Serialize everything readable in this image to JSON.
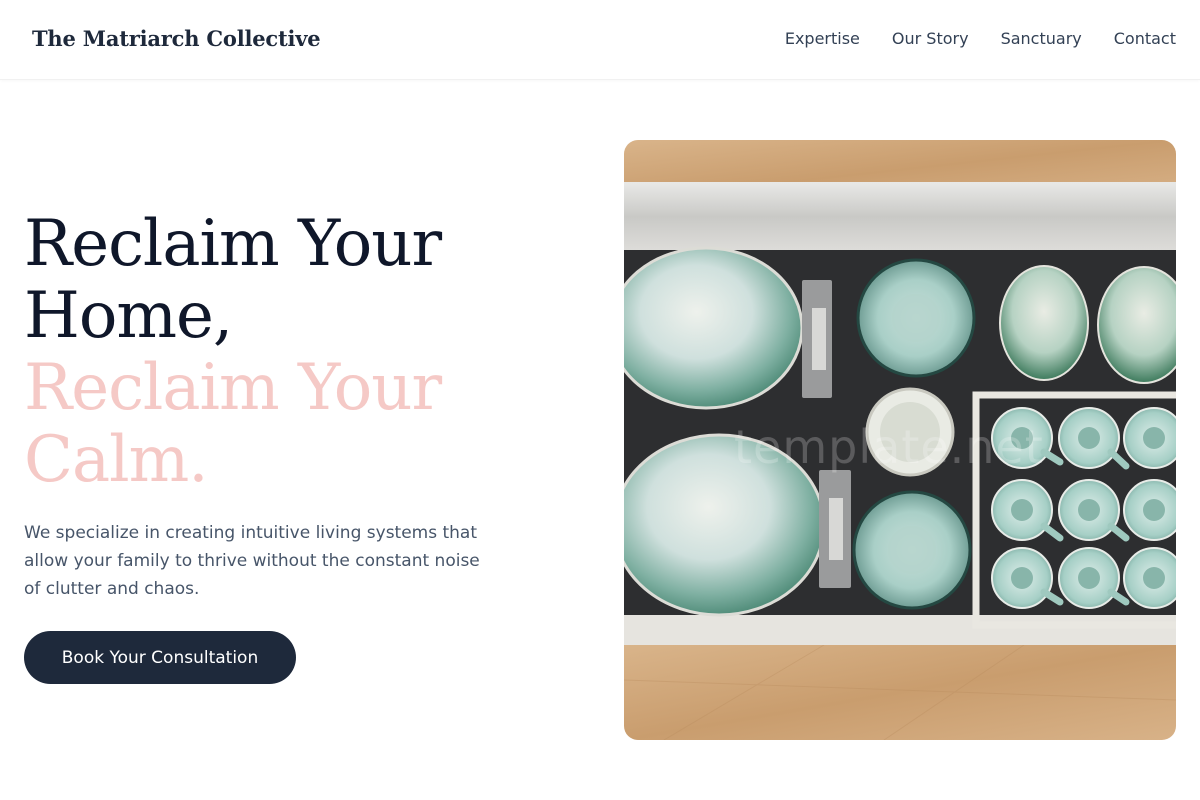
{
  "brand": {
    "name": "The Matriarch Collective"
  },
  "nav": {
    "items": [
      {
        "label": "Expertise"
      },
      {
        "label": "Our Story"
      },
      {
        "label": "Sanctuary"
      },
      {
        "label": "Contact"
      }
    ]
  },
  "hero": {
    "title_line1": "Reclaim Your",
    "title_line2": "Home,",
    "accent_line1": "Reclaim Your",
    "accent_line2": "Calm.",
    "subtitle": "We specialize in creating intuitive living systems that allow your family to thrive without the constant noise of clutter and chaos.",
    "cta_label": "Book Your Consultation",
    "image_watermark": "template.net"
  },
  "colors": {
    "primary_dark": "#1e293b",
    "accent_pink": "#f5c9c6",
    "body_text": "#475569"
  }
}
